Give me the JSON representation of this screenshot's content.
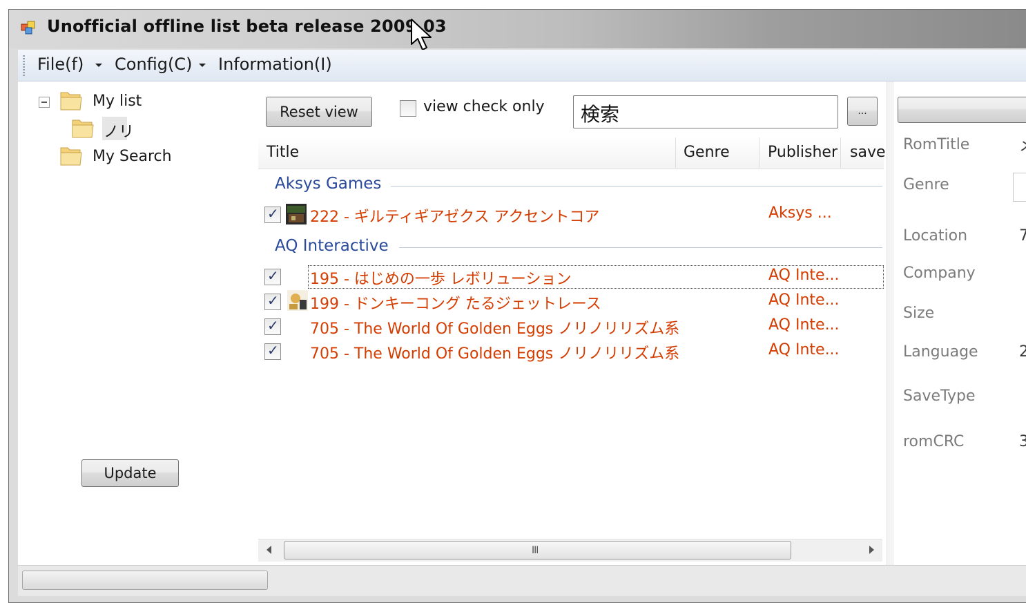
{
  "window": {
    "title": "Unofficial offline list beta release 2009.03"
  },
  "menu": {
    "items": [
      {
        "label": "File(f)"
      },
      {
        "label": "Config(C)"
      },
      {
        "label": "Information(I)"
      }
    ]
  },
  "tree": {
    "items": [
      {
        "label": "My list"
      },
      {
        "label": "ノリ"
      },
      {
        "label": "My Search"
      }
    ]
  },
  "toolbar": {
    "reset_label": "Reset view",
    "view_check_label": "view check only",
    "search_value": "検索",
    "ellipsis_label": "..."
  },
  "list": {
    "columns": [
      "Title",
      "Genre",
      "Publisher",
      "save"
    ],
    "groups": [
      {
        "name": "Aksys Games",
        "rows": [
          {
            "title": "222 - ギルティギアゼクス アクセントコア",
            "publisher": "Aksys ...",
            "checked": true
          }
        ]
      },
      {
        "name": "AQ Interactive",
        "rows": [
          {
            "title": "195 - はじめの一歩 レボリューション",
            "publisher": "AQ Inte...",
            "checked": true
          },
          {
            "title": "199 - ドンキーコング たるジェットレース",
            "publisher": "AQ Inte...",
            "checked": true
          },
          {
            "title": "705 - The World Of Golden Eggs ノリノリリズム系",
            "publisher": "AQ Inte...",
            "checked": true
          },
          {
            "title": "705 - The World Of Golden Eggs ノリノリリズム系",
            "publisher": "AQ Inte...",
            "checked": true
          }
        ]
      }
    ],
    "scroll_grip": "III"
  },
  "details": {
    "labels": [
      "RomTitle",
      "Genre",
      "Location",
      "Company",
      "Size",
      "Language",
      "SaveType",
      "romCRC"
    ],
    "values": {
      "romtitle": "メ",
      "location": "7",
      "language": "2",
      "romcrc": "3"
    }
  },
  "buttons": {
    "update_label": "Update"
  },
  "colors": {
    "accent_group": "#2a4a9a",
    "row_text": "#d43c00"
  }
}
